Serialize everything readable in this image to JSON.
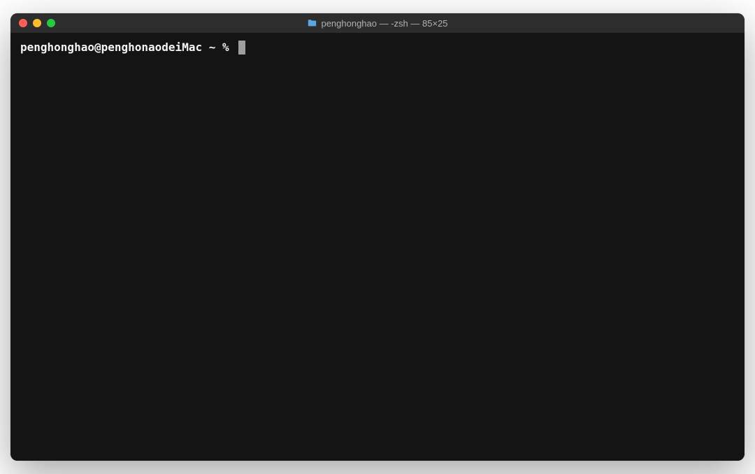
{
  "window": {
    "title": "penghonghao — -zsh — 85×25"
  },
  "terminal": {
    "prompt": "penghonghao@penghonaodeiMac ~ % ",
    "input_value": ""
  }
}
